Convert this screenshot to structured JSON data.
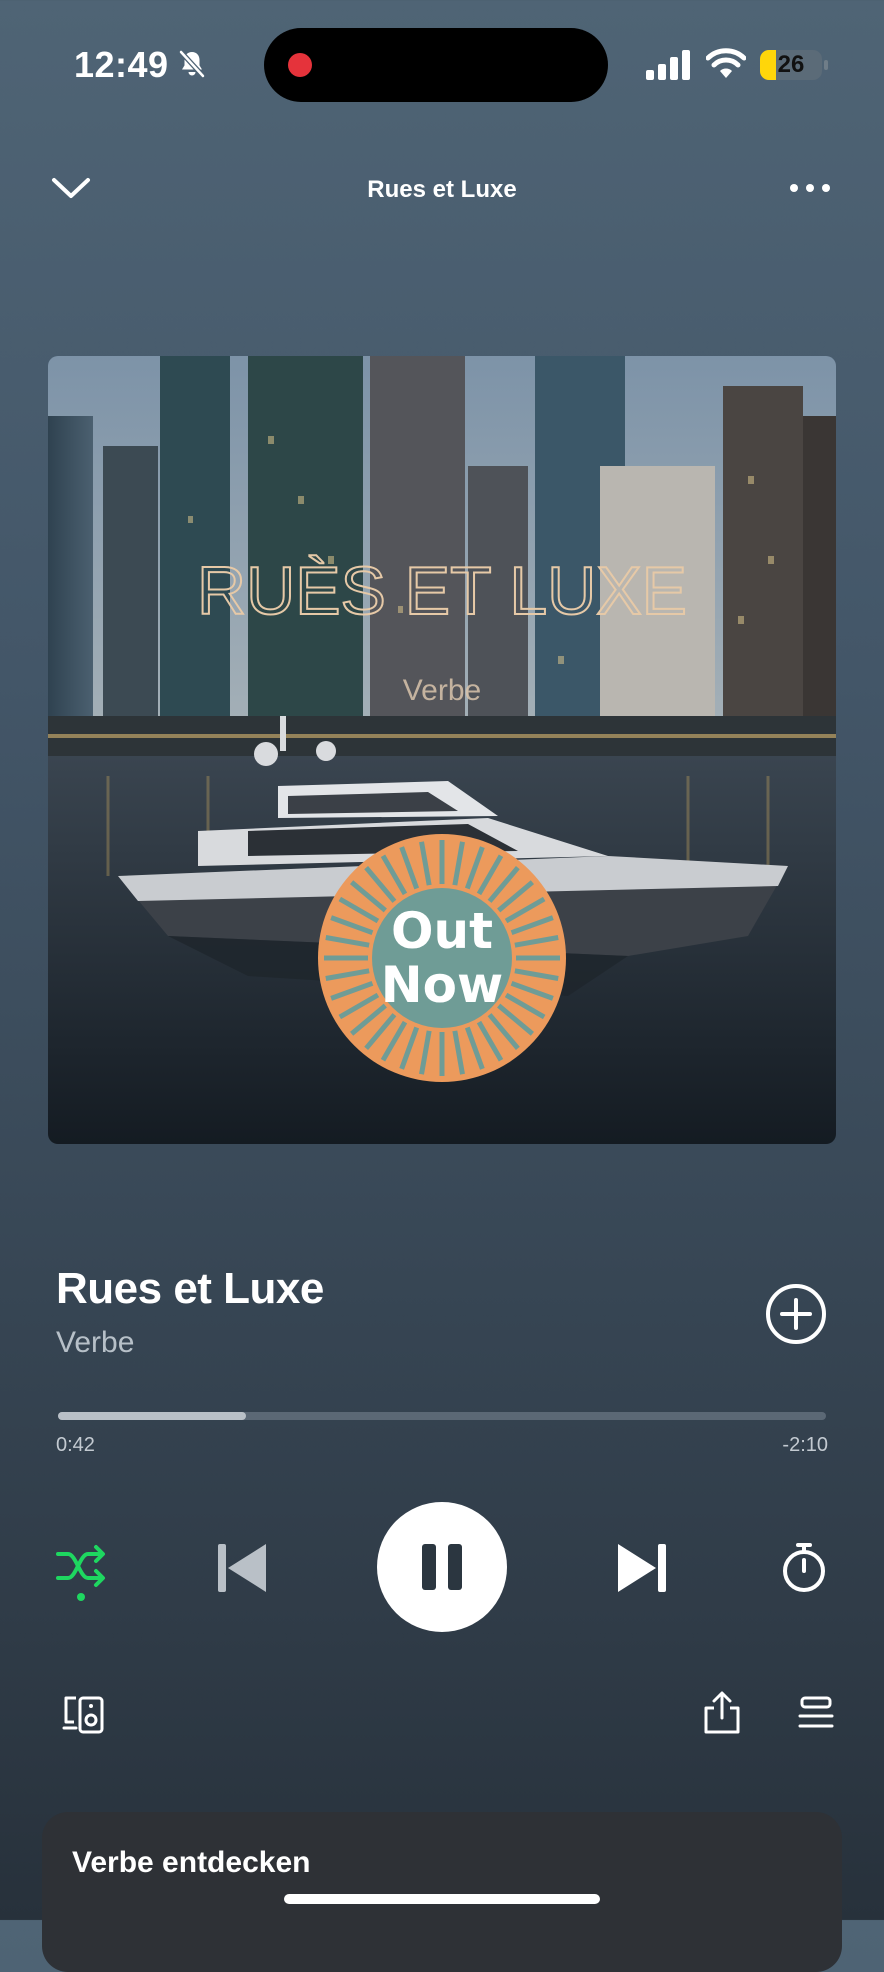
{
  "status_bar": {
    "time": "12:49",
    "battery": "26",
    "battery_level_percent": 26
  },
  "header": {
    "title": "Rues et Luxe"
  },
  "artwork": {
    "headline": "RUÈS ET LUXE",
    "artist": "Verbe",
    "badge_line1": "Out",
    "badge_line2": "Now"
  },
  "track": {
    "title": "Rues et Luxe",
    "artist": "Verbe"
  },
  "playback": {
    "elapsed": "0:42",
    "remaining": "-2:10",
    "progress_fraction": 0.245,
    "shuffle_on": true,
    "state": "playing"
  },
  "colors": {
    "accent_green": "#1ed760",
    "badge_orange": "#ec9a5c",
    "badge_teal": "#6f9c96"
  },
  "icons": {
    "collapse": "chevron-down-icon",
    "more": "more-dots-icon",
    "add": "plus-circle-icon",
    "shuffle": "shuffle-icon",
    "previous": "skip-previous-icon",
    "pause": "pause-icon",
    "next": "skip-next-icon",
    "sleep_timer": "timer-icon",
    "devices": "connect-devices-icon",
    "share": "share-icon",
    "queue": "queue-icon"
  },
  "discover_card": {
    "title": "Verbe entdecken"
  }
}
